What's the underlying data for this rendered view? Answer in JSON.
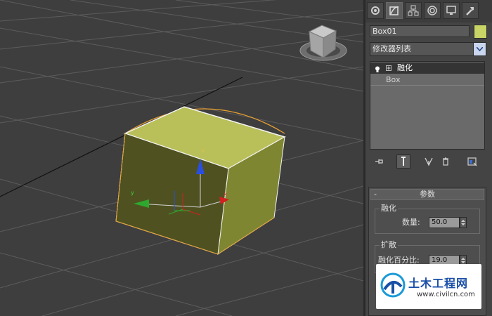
{
  "viewport": {
    "gizmo_labels": {
      "z": "z",
      "y": "y",
      "x": "x"
    }
  },
  "panel": {
    "tabs": [
      {
        "icon": "create-icon",
        "active": false
      },
      {
        "icon": "modify-icon",
        "active": true
      },
      {
        "icon": "hierarchy-icon",
        "active": false
      },
      {
        "icon": "motion-icon",
        "active": false
      },
      {
        "icon": "display-icon",
        "active": false
      },
      {
        "icon": "utilities-icon",
        "active": false
      }
    ],
    "object_name": "Box01",
    "object_color": "#c8d465",
    "modifier_list": "修改器列表",
    "stack": {
      "selected": "融化",
      "base": "Box"
    },
    "rollout": {
      "collapse_symbol": "-",
      "title": "参数",
      "melt_group": {
        "title": "融化",
        "amount_label": "数量:",
        "amount_value": "50.0"
      },
      "spread_group": {
        "title": "扩散",
        "percent_label": "融化百分比:",
        "percent_value": "19.0"
      }
    }
  },
  "watermark": {
    "name": "土木工程网",
    "url": "www.civilcn.com"
  }
}
